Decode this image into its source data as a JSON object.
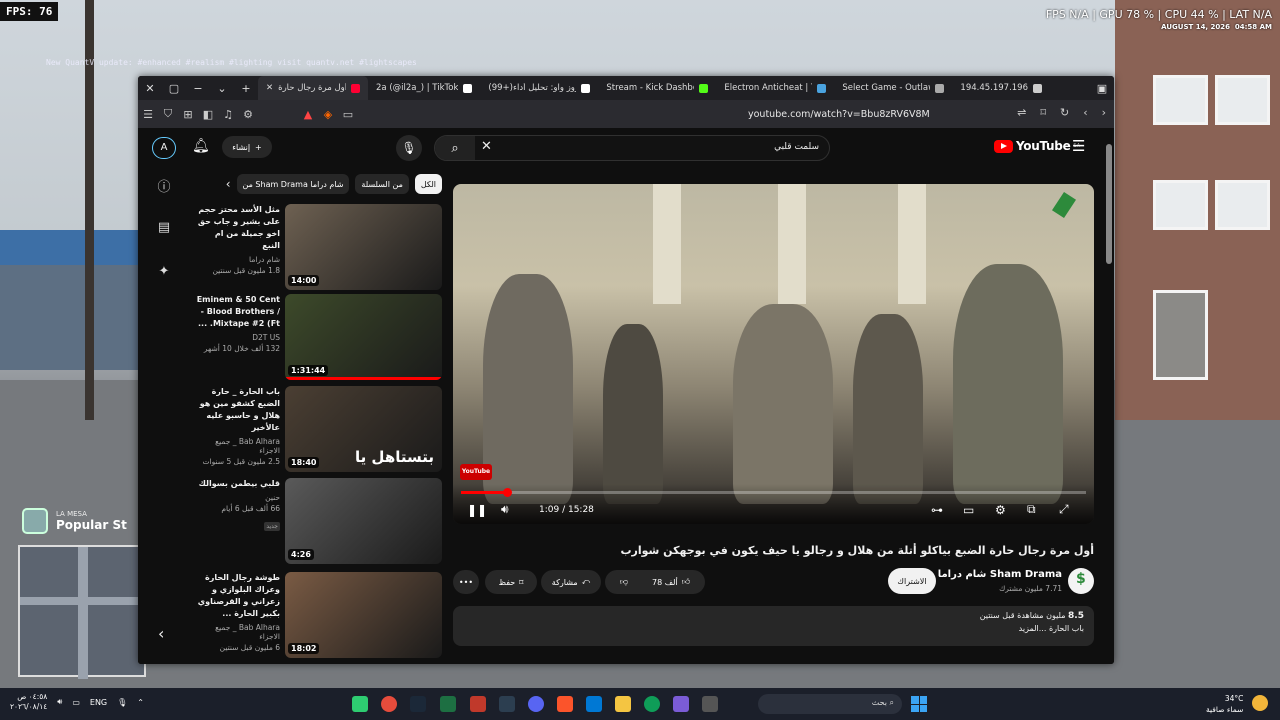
{
  "hud": {
    "fps_label": "FPS: 76",
    "stats": "FPS N/A  |  GPU 78 %  |  CPU 44 %  |  LAT N/A",
    "date": "AUGUST 14, 2026",
    "time": "04:58 AM",
    "overlay_text": "New QuantV update: #enhanced #realism #lighting visit quantv.net #lightscapes"
  },
  "minimap": {
    "area": "LA MESA",
    "street": "Popular St"
  },
  "browser": {
    "tabs": [
      {
        "label": "أول مرة رجال حارة",
        "color": "#ff0033",
        "active": true
      },
      {
        "label": "2a (@il2a_) | TikTok",
        "color": "#ffffff",
        "active": false
      },
      {
        "label": "(99+)عزوز واو: تحليل أداء",
        "color": "#ffffff",
        "active": false
      },
      {
        "label": "Stream - Kick Dashboard",
        "color": "#53fc18",
        "active": false
      },
      {
        "label": "Electron Anticheat | The",
        "color": "#4aa3df",
        "active": false
      },
      {
        "label": "Select Game - Outlaw",
        "color": "#aaaaaa",
        "active": false
      },
      {
        "label": "194.45.197.196",
        "color": "#cccccc",
        "active": false
      }
    ],
    "url": "youtube.com/watch?v=Bbu8zRV6V8M",
    "shield_count": "99+"
  },
  "youtube": {
    "create_label": "إنشاء",
    "search_query": "سلمت قلبي",
    "logo_text": "YouTube",
    "logo_region": "SA",
    "chips": [
      "الكل",
      "من السلسلة",
      "من Sham Drama",
      "شام دراما"
    ],
    "recommendations": [
      {
        "title": "مثل الأسد محتز حجم على بشير و جاب حق اخو جميلة من ام النبع",
        "channel": "شام دراما",
        "meta": "1.8 مليون  قبل سنتين",
        "duration": "14:00",
        "progress": 0,
        "thumb": "#6e6152"
      },
      {
        "title": "Eminem & 50 Cent - Blood Brothers / Mixtape #2 (Ft. ...",
        "channel": "D2T US",
        "meta": "132 ألف  خلال 10 أشهر",
        "duration": "1:31:44",
        "progress": 1,
        "thumb": "#3d4a2a"
      },
      {
        "title": "باب الحارة _ حارة الضبع كشفو مين هو هلال و حاسبو عليه عالأخير",
        "channel": "Bab Alhara _ جميع الاجزاء",
        "meta": "2.5 مليون  قبل 5 سنوات",
        "duration": "18:40",
        "progress": 0,
        "thumb": "#4b3f33",
        "overlay": "بتستاهل يا"
      },
      {
        "title": "قلبي بيطمن بسوالك",
        "channel": "حنين",
        "meta": "66 ألف  قبل 6 أيام",
        "duration": "4:26",
        "progress": 0,
        "thumb": "#5a5a5a",
        "badge": "جديد"
      },
      {
        "title": "طوشة رجال الحارة وعراك البلوازي و زعراني و القرصناوي بكبير الحارة ...",
        "channel": "Bab Alhara _ جميع الاجزاء",
        "meta": "6 مليون  قبل سنتين",
        "duration": "18:02",
        "progress": 0,
        "thumb": "#7a5b44"
      }
    ],
    "player": {
      "time": "1:09 / 15:28",
      "progress": 0.074,
      "watermark": "YouTube"
    },
    "video_title": "أول مرة رجال حارة الضبع بياكلو أتلة من هلال و رجالو يا حيف يكون في بوجهكن شوارب",
    "channel_name": "Sham Drama شام دراما",
    "subscribers": "7.71 مليون مشترك",
    "subscribe_label": "الاشتراك",
    "likes": "78 ألف",
    "share_label": "مشاركة",
    "save_label": "حفظ",
    "views": "8.5",
    "views_suffix": "مليون مشاهدة  قبل سنتين",
    "description": "باب الحارة ...المزيد"
  },
  "taskbar": {
    "clock_time": "٠٤:٥٨ ص",
    "clock_date": "٢٠٢٦/٠٨/١٤",
    "lang": "ENG",
    "search_placeholder": "بحث",
    "temperature": "34°C",
    "weather_desc": "سماء صافية"
  }
}
